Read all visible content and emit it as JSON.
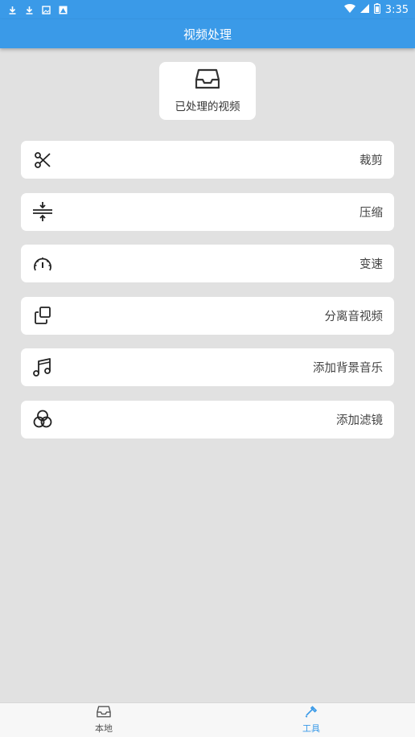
{
  "statusbar": {
    "time": "3:35",
    "left_icons": [
      "download-icon",
      "download-icon",
      "image-icon",
      "photo-icon"
    ],
    "right_icons": [
      "wifi-icon",
      "signal-icon",
      "battery-icon"
    ]
  },
  "header": {
    "title": "视频处理"
  },
  "processed": {
    "label": "已处理的视频",
    "icon": "inbox-icon"
  },
  "menu": [
    {
      "label": "裁剪",
      "icon": "scissors-icon"
    },
    {
      "label": "压缩",
      "icon": "compress-icon"
    },
    {
      "label": "变速",
      "icon": "speedometer-icon"
    },
    {
      "label": "分离音视频",
      "icon": "copy-icon"
    },
    {
      "label": "添加背景音乐",
      "icon": "music-note-icon"
    },
    {
      "label": "添加滤镜",
      "icon": "filter-icon"
    }
  ],
  "bottom_nav": {
    "tabs": [
      {
        "label": "本地",
        "icon": "inbox-icon",
        "active": false
      },
      {
        "label": "工具",
        "icon": "tools-icon",
        "active": true
      }
    ]
  },
  "colors": {
    "primary": "#3a9ae8",
    "background": "#e1e1e1",
    "card": "#ffffff"
  }
}
